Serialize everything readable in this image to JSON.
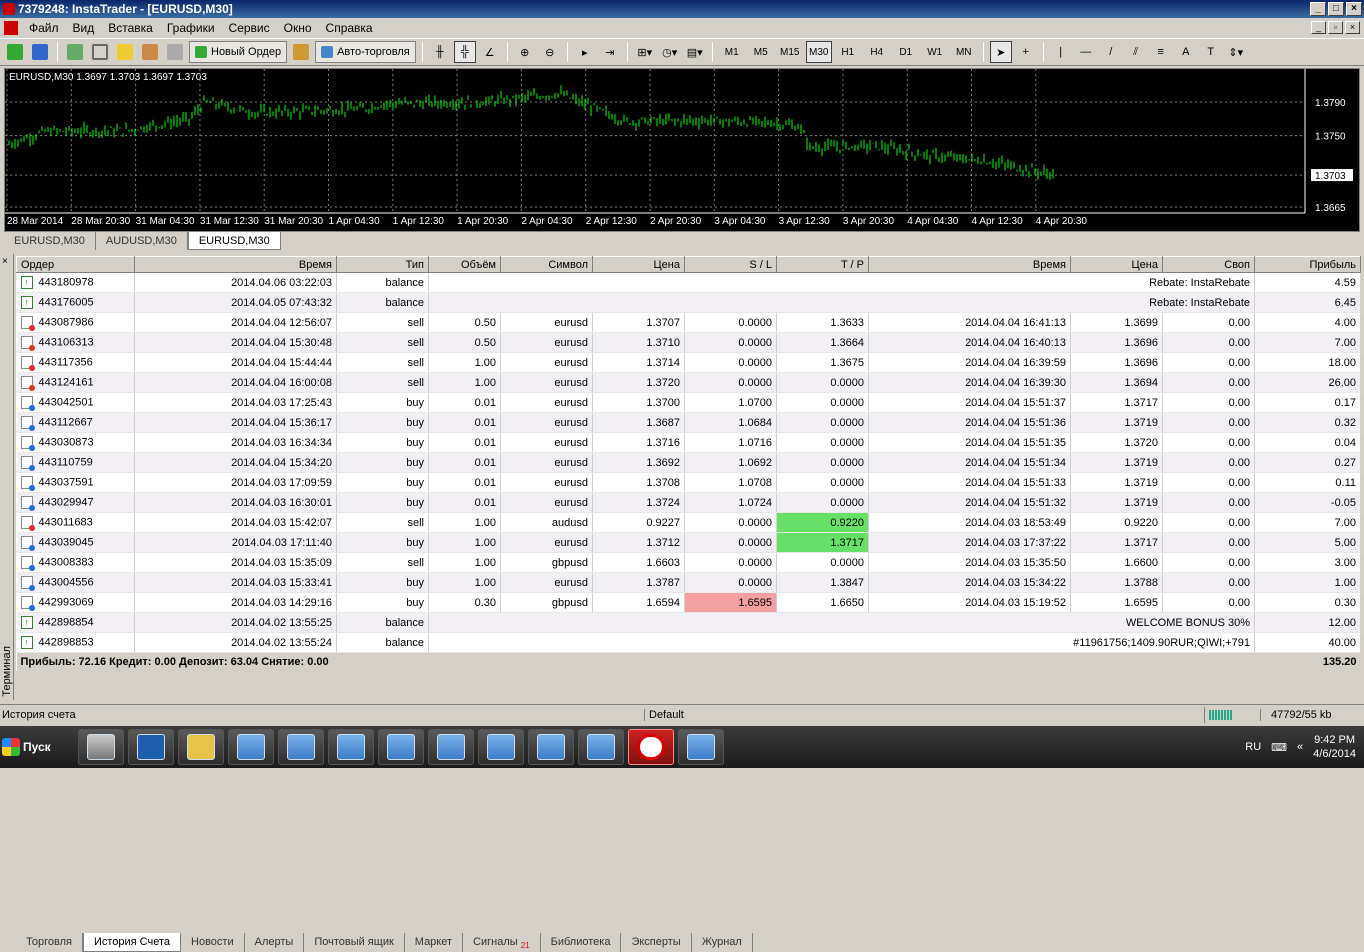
{
  "window": {
    "title": "7379248: InstaTrader - [EURUSD,M30]"
  },
  "menu": [
    "Файл",
    "Вид",
    "Вставка",
    "Графики",
    "Сервис",
    "Окно",
    "Справка"
  ],
  "toolbar": {
    "new_order": "Новый Ордер",
    "auto_trading": "Авто-торговля",
    "timeframes": [
      "M1",
      "M5",
      "M15",
      "M30",
      "H1",
      "H4",
      "D1",
      "W1",
      "MN"
    ],
    "active_tf": "M30"
  },
  "chart": {
    "label": "EURUSD,M30  1.3697 1.3703 1.3697 1.3703",
    "price_levels": [
      "1.3790",
      "1.3750",
      "1.3703",
      "1.3665"
    ],
    "current_price": "1.3703",
    "time_labels": [
      "28 Mar 2014",
      "28 Mar 20:30",
      "31 Mar 04:30",
      "31 Mar 12:30",
      "31 Mar 20:30",
      "1 Apr 04:30",
      "1 Apr 12:30",
      "1 Apr 20:30",
      "2 Apr 04:30",
      "2 Apr 12:30",
      "2 Apr 20:30",
      "3 Apr 04:30",
      "3 Apr 12:30",
      "3 Apr 20:30",
      "4 Apr 04:30",
      "4 Apr 12:30",
      "4 Apr 20:30"
    ],
    "colors": {
      "bg": "#000000",
      "candle": "#00ff00",
      "grid": "#808080"
    }
  },
  "chart_tabs": [
    "EURUSD,M30",
    "AUDUSD,M30",
    "EURUSD,M30"
  ],
  "columns": [
    "Ордер",
    "Время",
    "Тип",
    "Объём",
    "Символ",
    "Цена",
    "S / L",
    "T / P",
    "Время",
    "Цена",
    "Своп",
    "Прибыль"
  ],
  "rows": [
    {
      "kind": "balance",
      "order": "443180978",
      "time": "2014.04.06 03:22:03",
      "type": "balance",
      "comment": "Rebate: InstaRebate",
      "profit": "4.59"
    },
    {
      "kind": "balance",
      "order": "443176005",
      "time": "2014.04.05 07:43:32",
      "type": "balance",
      "comment": "Rebate: InstaRebate",
      "profit": "6.45"
    },
    {
      "kind": "sell",
      "order": "443087986",
      "time": "2014.04.04 12:56:07",
      "type": "sell",
      "vol": "0.50",
      "sym": "eurusd",
      "price": "1.3707",
      "sl": "0.0000",
      "tp": "1.3633",
      "ctime": "2014.04.04 16:41:13",
      "cprice": "1.3699",
      "swap": "0.00",
      "profit": "4.00"
    },
    {
      "kind": "sell",
      "order": "443106313",
      "time": "2014.04.04 15:30:48",
      "type": "sell",
      "vol": "0.50",
      "sym": "eurusd",
      "price": "1.3710",
      "sl": "0.0000",
      "tp": "1.3664",
      "ctime": "2014.04.04 16:40:13",
      "cprice": "1.3696",
      "swap": "0.00",
      "profit": "7.00"
    },
    {
      "kind": "sell",
      "order": "443117356",
      "time": "2014.04.04 15:44:44",
      "type": "sell",
      "vol": "1.00",
      "sym": "eurusd",
      "price": "1.3714",
      "sl": "0.0000",
      "tp": "1.3675",
      "ctime": "2014.04.04 16:39:59",
      "cprice": "1.3696",
      "swap": "0.00",
      "profit": "18.00"
    },
    {
      "kind": "sell",
      "order": "443124161",
      "time": "2014.04.04 16:00:08",
      "type": "sell",
      "vol": "1.00",
      "sym": "eurusd",
      "price": "1.3720",
      "sl": "0.0000",
      "tp": "0.0000",
      "ctime": "2014.04.04 16:39:30",
      "cprice": "1.3694",
      "swap": "0.00",
      "profit": "26.00"
    },
    {
      "kind": "buy",
      "order": "443042501",
      "time": "2014.04.03 17:25:43",
      "type": "buy",
      "vol": "0.01",
      "sym": "eurusd",
      "price": "1.3700",
      "sl": "1.0700",
      "tp": "0.0000",
      "ctime": "2014.04.04 15:51:37",
      "cprice": "1.3717",
      "swap": "0.00",
      "profit": "0.17"
    },
    {
      "kind": "buy",
      "order": "443112667",
      "time": "2014.04.04 15:36:17",
      "type": "buy",
      "vol": "0.01",
      "sym": "eurusd",
      "price": "1.3687",
      "sl": "1.0684",
      "tp": "0.0000",
      "ctime": "2014.04.04 15:51:36",
      "cprice": "1.3719",
      "swap": "0.00",
      "profit": "0.32"
    },
    {
      "kind": "buy",
      "order": "443030873",
      "time": "2014.04.03 16:34:34",
      "type": "buy",
      "vol": "0.01",
      "sym": "eurusd",
      "price": "1.3716",
      "sl": "1.0716",
      "tp": "0.0000",
      "ctime": "2014.04.04 15:51:35",
      "cprice": "1.3720",
      "swap": "0.00",
      "profit": "0.04"
    },
    {
      "kind": "buy",
      "order": "443110759",
      "time": "2014.04.04 15:34:20",
      "type": "buy",
      "vol": "0.01",
      "sym": "eurusd",
      "price": "1.3692",
      "sl": "1.0692",
      "tp": "0.0000",
      "ctime": "2014.04.04 15:51:34",
      "cprice": "1.3719",
      "swap": "0.00",
      "profit": "0.27"
    },
    {
      "kind": "buy",
      "order": "443037591",
      "time": "2014.04.03 17:09:59",
      "type": "buy",
      "vol": "0.01",
      "sym": "eurusd",
      "price": "1.3708",
      "sl": "1.0708",
      "tp": "0.0000",
      "ctime": "2014.04.04 15:51:33",
      "cprice": "1.3719",
      "swap": "0.00",
      "profit": "0.11"
    },
    {
      "kind": "buy",
      "order": "443029947",
      "time": "2014.04.03 16:30:01",
      "type": "buy",
      "vol": "0.01",
      "sym": "eurusd",
      "price": "1.3724",
      "sl": "1.0724",
      "tp": "0.0000",
      "ctime": "2014.04.04 15:51:32",
      "cprice": "1.3719",
      "swap": "0.00",
      "profit": "-0.05"
    },
    {
      "kind": "sell",
      "order": "443011683",
      "time": "2014.04.03 15:42:07",
      "type": "sell",
      "vol": "1.00",
      "sym": "audusd",
      "price": "0.9227",
      "sl": "0.0000",
      "tp": "0.9220",
      "tp_hit": true,
      "ctime": "2014.04.03 18:53:49",
      "cprice": "0.9220",
      "swap": "0.00",
      "profit": "7.00"
    },
    {
      "kind": "buy",
      "order": "443039045",
      "time": "2014.04.03 17:11:40",
      "type": "buy",
      "vol": "1.00",
      "sym": "eurusd",
      "price": "1.3712",
      "sl": "0.0000",
      "tp": "1.3717",
      "tp_hit": true,
      "ctime": "2014.04.03 17:37:22",
      "cprice": "1.3717",
      "swap": "0.00",
      "profit": "5.00"
    },
    {
      "kind": "buy",
      "order": "443008383",
      "time": "2014.04.03 15:35:09",
      "type": "sell",
      "vol": "1.00",
      "sym": "gbpusd",
      "price": "1.6603",
      "sl": "0.0000",
      "tp": "0.0000",
      "ctime": "2014.04.03 15:35:50",
      "cprice": "1.6600",
      "swap": "0.00",
      "profit": "3.00"
    },
    {
      "kind": "buy",
      "order": "443004556",
      "time": "2014.04.03 15:33:41",
      "type": "buy",
      "vol": "1.00",
      "sym": "eurusd",
      "price": "1.3787",
      "sl": "0.0000",
      "tp": "1.3847",
      "ctime": "2014.04.03 15:34:22",
      "cprice": "1.3788",
      "swap": "0.00",
      "profit": "1.00"
    },
    {
      "kind": "buy",
      "order": "442993069",
      "time": "2014.04.03 14:29:16",
      "type": "buy",
      "vol": "0.30",
      "sym": "gbpusd",
      "price": "1.6594",
      "sl": "1.6595",
      "sl_hit": true,
      "tp": "1.6650",
      "ctime": "2014.04.03 15:19:52",
      "cprice": "1.6595",
      "swap": "0.00",
      "profit": "0.30"
    },
    {
      "kind": "balance",
      "order": "442898854",
      "time": "2014.04.02 13:55:25",
      "type": "balance",
      "comment": "WELCOME BONUS 30%",
      "profit": "12.00"
    },
    {
      "kind": "balance",
      "order": "442898853",
      "time": "2014.04.02 13:55:24",
      "type": "balance",
      "comment": "#11961756;1409.90RUR;QIWI;+791",
      "profit": "40.00"
    }
  ],
  "summary": {
    "text": "Прибыль: 72.16  Кредит: 0.00  Депозит: 63.04  Снятие: 0.00",
    "total": "135.20"
  },
  "terminal_label": "Терминал",
  "bottom_tabs": [
    "Торговля",
    "История Счета",
    "Новости",
    "Алерты",
    "Почтовый ящик",
    "Маркет",
    "Сигналы",
    "Библиотека",
    "Эксперты",
    "Журнал"
  ],
  "signals_badge": "21",
  "status": {
    "left": "История счета",
    "profile": "Default",
    "traffic": "47792/55 kb"
  },
  "taskbar": {
    "start": "Пуск",
    "lang": "RU",
    "time": "9:42 PM",
    "date": "4/6/2014"
  }
}
